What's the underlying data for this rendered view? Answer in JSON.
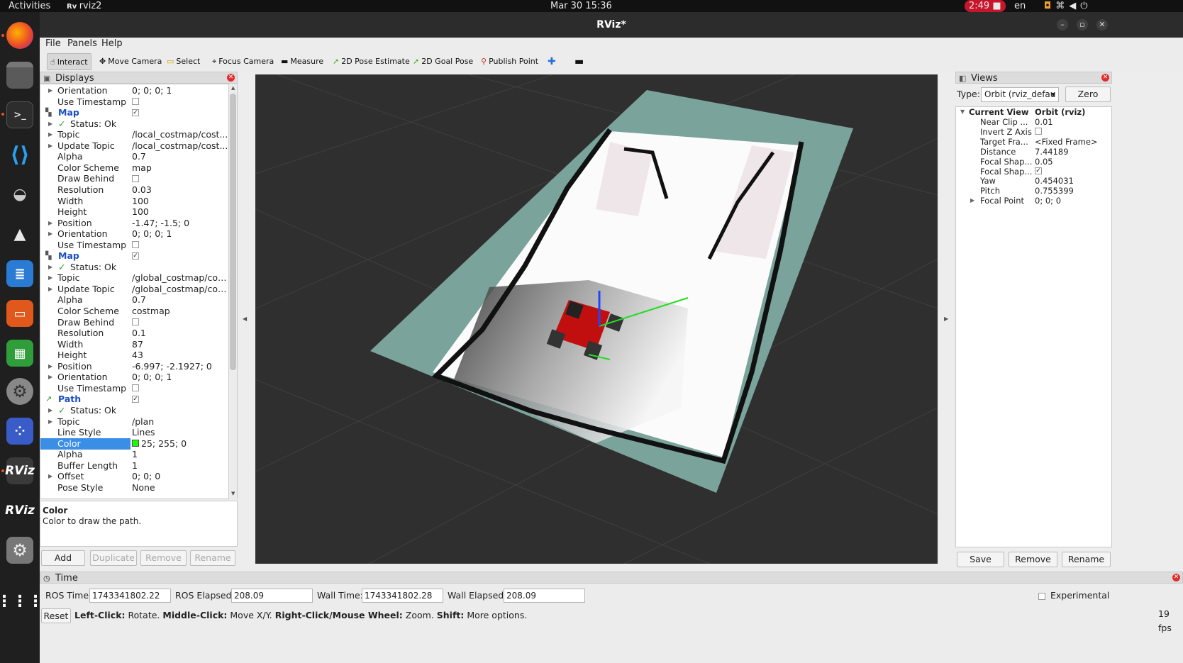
{
  "system": {
    "activities": "Activities",
    "app": "rviz2",
    "datetime": "Mar 30  15:36",
    "recording": "2:49",
    "lang": "en"
  },
  "window": {
    "title": "RViz*"
  },
  "menu": [
    "File",
    "Panels",
    "Help"
  ],
  "toolbar": [
    "Interact",
    "Move Camera",
    "Select",
    "Focus Camera",
    "Measure",
    "2D Pose Estimate",
    "2D Goal Pose",
    "Publish Point"
  ],
  "displays": {
    "title": "Displays",
    "rows": [
      {
        "k": "Orientation",
        "v": "0; 0; 0; 1",
        "arr": true,
        "ind": 1
      },
      {
        "k": "Use Timestamp",
        "cb": "",
        "ind": 1
      },
      {
        "k": "Map",
        "cb": "✓",
        "head": true
      },
      {
        "k": "Status: Ok",
        "arr": true,
        "ok": true,
        "ind": 1
      },
      {
        "k": "Topic",
        "v": "/local_costmap/cost...",
        "arr": true,
        "ind": 1
      },
      {
        "k": "Update Topic",
        "v": "/local_costmap/cost...",
        "arr": true,
        "ind": 1
      },
      {
        "k": "Alpha",
        "v": "0.7",
        "ind": 1
      },
      {
        "k": "Color Scheme",
        "v": "map",
        "ind": 1
      },
      {
        "k": "Draw Behind",
        "cb": "",
        "ind": 1
      },
      {
        "k": "Resolution",
        "v": "0.03",
        "ind": 1
      },
      {
        "k": "Width",
        "v": "100",
        "ind": 1
      },
      {
        "k": "Height",
        "v": "100",
        "ind": 1
      },
      {
        "k": "Position",
        "v": "-1.47; -1.5; 0",
        "arr": true,
        "ind": 1
      },
      {
        "k": "Orientation",
        "v": "0; 0; 0; 1",
        "arr": true,
        "ind": 1
      },
      {
        "k": "Use Timestamp",
        "cb": "",
        "ind": 1
      },
      {
        "k": "Map",
        "cb": "✓",
        "head": true
      },
      {
        "k": "Status: Ok",
        "arr": true,
        "ok": true,
        "ind": 1
      },
      {
        "k": "Topic",
        "v": "/global_costmap/cost...",
        "arr": true,
        "ind": 1
      },
      {
        "k": "Update Topic",
        "v": "/global_costmap/cost...",
        "arr": true,
        "ind": 1
      },
      {
        "k": "Alpha",
        "v": "0.7",
        "ind": 1
      },
      {
        "k": "Color Scheme",
        "v": "costmap",
        "ind": 1
      },
      {
        "k": "Draw Behind",
        "cb": "",
        "ind": 1
      },
      {
        "k": "Resolution",
        "v": "0.1",
        "ind": 1
      },
      {
        "k": "Width",
        "v": "87",
        "ind": 1
      },
      {
        "k": "Height",
        "v": "43",
        "ind": 1
      },
      {
        "k": "Position",
        "v": "-6.997; -2.1927; 0",
        "arr": true,
        "ind": 1
      },
      {
        "k": "Orientation",
        "v": "0; 0; 0; 1",
        "arr": true,
        "ind": 1
      },
      {
        "k": "Use Timestamp",
        "cb": "",
        "ind": 1
      },
      {
        "k": "Path",
        "cb": "✓",
        "head": true,
        "path": true
      },
      {
        "k": "Status: Ok",
        "arr": true,
        "ok": true,
        "ind": 1
      },
      {
        "k": "Topic",
        "v": "/plan",
        "arr": true,
        "ind": 1
      },
      {
        "k": "Line Style",
        "v": "Lines",
        "ind": 1
      },
      {
        "k": "Color",
        "v": "25; 255; 0",
        "swatch": "#19ff00",
        "sel": true,
        "ind": 1
      },
      {
        "k": "Alpha",
        "v": "1",
        "ind": 1
      },
      {
        "k": "Buffer Length",
        "v": "1",
        "ind": 1
      },
      {
        "k": "Offset",
        "v": "0; 0; 0",
        "arr": true,
        "ind": 1
      },
      {
        "k": "Pose Style",
        "v": "None",
        "ind": 1
      }
    ],
    "desc_title": "Color",
    "desc_text": "Color to draw the path.",
    "buttons": [
      "Add",
      "Duplicate",
      "Remove",
      "Rename"
    ]
  },
  "views": {
    "title": "Views",
    "type_label": "Type:",
    "type_value": "Orbit (rviz_defau",
    "zero": "Zero",
    "head_k": "Current View",
    "head_v": "Orbit (rviz)",
    "rows": [
      {
        "k": "Near Clip ...",
        "v": "0.01"
      },
      {
        "k": "Invert Z Axis",
        "cb": ""
      },
      {
        "k": "Target Fra...",
        "v": "<Fixed Frame>"
      },
      {
        "k": "Distance",
        "v": "7.44189"
      },
      {
        "k": "Focal Shap...",
        "v": "0.05"
      },
      {
        "k": "Focal Shap...",
        "cb": "✓"
      },
      {
        "k": "Yaw",
        "v": "0.454031"
      },
      {
        "k": "Pitch",
        "v": "0.755399"
      },
      {
        "k": "Focal Point",
        "v": "0; 0; 0",
        "arr": true
      }
    ],
    "buttons": [
      "Save",
      "Remove",
      "Rename"
    ]
  },
  "time": {
    "title": "Time",
    "ros_time_label": "ROS Time:",
    "ros_time": "1743341802.22",
    "ros_elapsed_label": "ROS Elapsed:",
    "ros_elapsed": "208.09",
    "wall_time_label": "Wall Time:",
    "wall_time": "1743341802.28",
    "wall_elapsed_label": "Wall Elapsed:",
    "wall_elapsed": "208.09",
    "experimental": "Experimental",
    "reset": "Reset",
    "help_b1": "Left-Click:",
    "help_t1": " Rotate. ",
    "help_b2": "Middle-Click:",
    "help_t2": " Move X/Y. ",
    "help_b3": "Right-Click/Mouse Wheel:",
    "help_t3": " Zoom. ",
    "help_b4": "Shift:",
    "help_t4": " More options.",
    "fps": "19 fps"
  }
}
